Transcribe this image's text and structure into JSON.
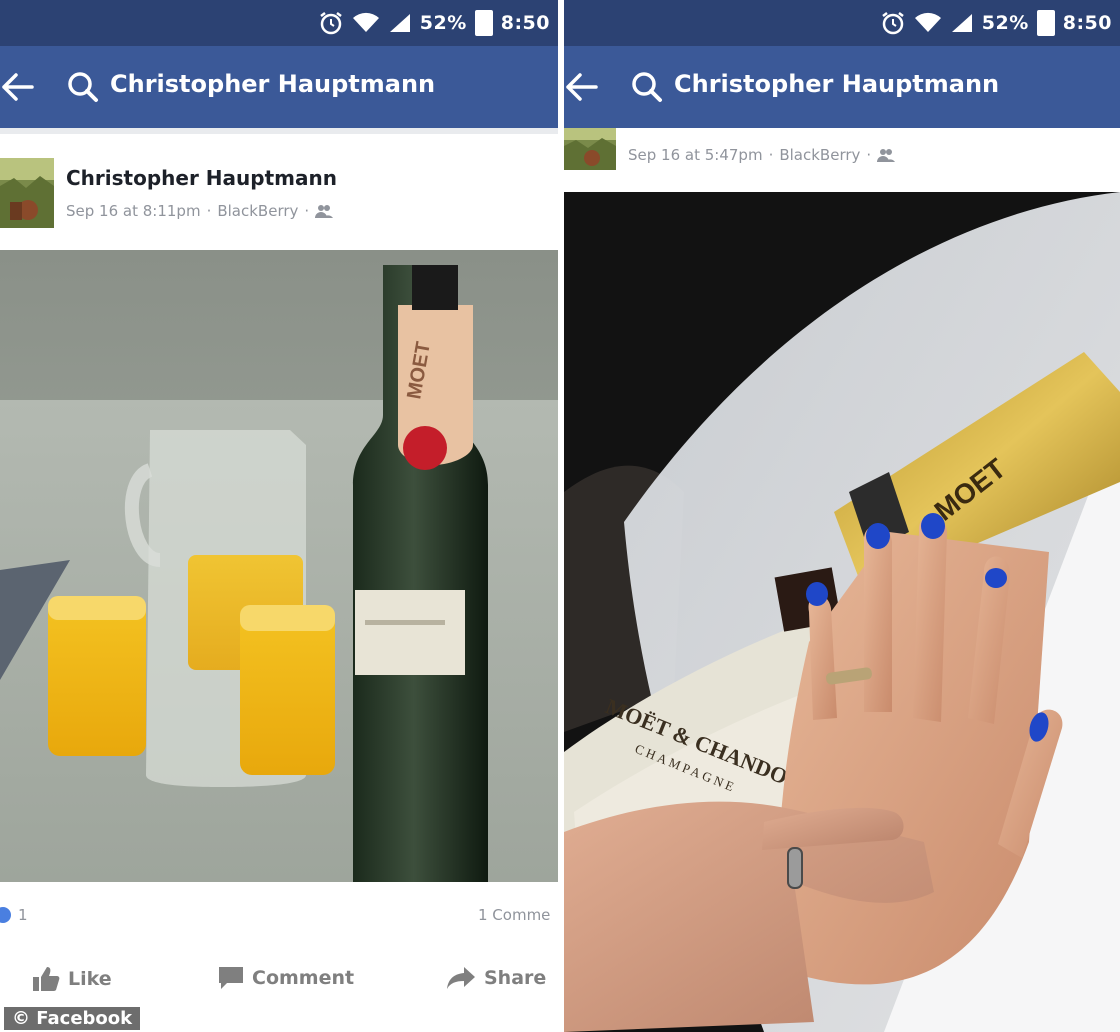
{
  "status_bar": {
    "battery": "52%",
    "time": "8:50"
  },
  "search": {
    "query": "Christopher Hauptmann"
  },
  "left_post": {
    "author": "Christopher Hauptmann",
    "date": "Sep 16 at 8:11pm",
    "source": "BlackBerry",
    "reactions_count": "1",
    "comments_count": "1 Comme",
    "like_label": "Like",
    "comment_label": "Comment",
    "share_label": "Share"
  },
  "right_post": {
    "date": "Sep 16 at 5:47pm",
    "source": "BlackBerry"
  },
  "photo_text": {
    "bottle_label": "MOET",
    "card_line1": "MOËT & CHANDON",
    "card_line2": "CHAMPAGNE"
  },
  "watermark": "© Facebook",
  "separator": "·",
  "colors": {
    "status_bar": "#2c4273",
    "nav_bar": "#3b5998",
    "nail_polish": "#1f47c8"
  },
  "icons": [
    "alarm-icon",
    "wifi-icon",
    "signal-icon",
    "battery-icon",
    "back-arrow-icon",
    "search-icon",
    "friends-icon",
    "reaction-icon",
    "like-icon",
    "comment-icon",
    "share-icon"
  ]
}
